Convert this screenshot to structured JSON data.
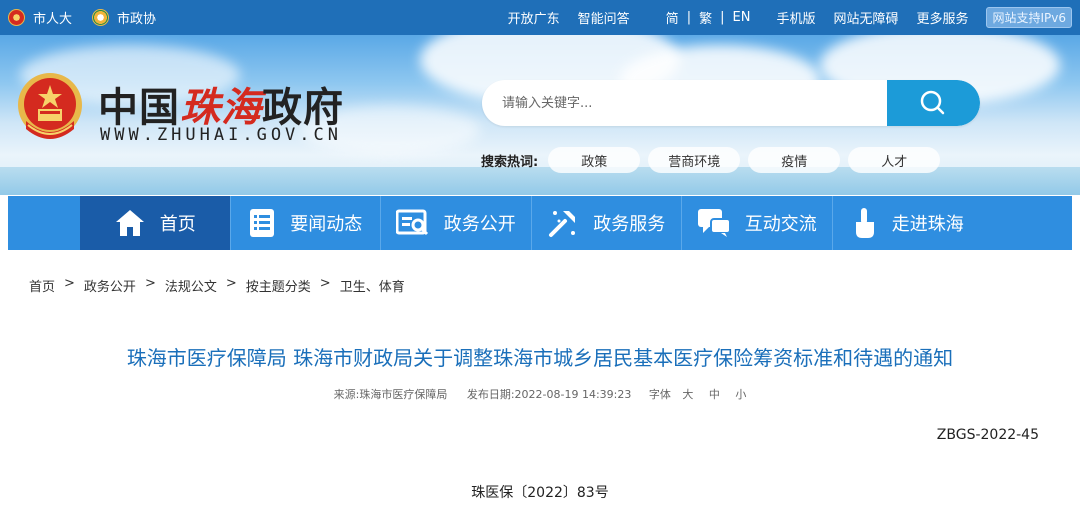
{
  "topbar": {
    "left_links": [
      {
        "label": "市人大",
        "icon": "national-emblem-icon"
      },
      {
        "label": "市政协",
        "icon": "cppcc-emblem-icon"
      }
    ],
    "right_links": [
      "开放广东",
      "智能问答"
    ],
    "languages": [
      "简",
      "繁",
      "EN"
    ],
    "lang_sep": "|",
    "more_links": [
      "手机版",
      "网站无障碍",
      "更多服务"
    ],
    "ipv6_badge": "网站支持IPv6"
  },
  "header": {
    "logo_cn_prefix": "中国",
    "logo_cn_city": "珠海",
    "logo_cn_suffix": "政府",
    "logo_en": "WWW.ZHUHAI.GOV.CN",
    "search": {
      "placeholder": "请输入关键字...",
      "icon": "search-icon"
    },
    "hot_label": "搜索热词:",
    "hot_tags": [
      "政策",
      "营商环境",
      "疫情",
      "人才"
    ]
  },
  "nav": {
    "items": [
      {
        "label": "首页",
        "icon": "home-icon"
      },
      {
        "label": "要闻动态",
        "icon": "news-list-icon"
      },
      {
        "label": "政务公开",
        "icon": "document-search-icon"
      },
      {
        "label": "政务服务",
        "icon": "tools-icon"
      },
      {
        "label": "互动交流",
        "icon": "chat-icon"
      },
      {
        "label": "走进珠海",
        "icon": "pointer-hand-icon"
      }
    ]
  },
  "breadcrumb": [
    "首页",
    "政务公开",
    "法规公文",
    "按主题分类",
    "卫生、体育"
  ],
  "breadcrumb_sep": ">",
  "article": {
    "title": "珠海市医疗保障局 珠海市财政局关于调整珠海市城乡居民基本医疗保险筹资标准和待遇的通知",
    "source_label": "来源:",
    "source": "珠海市医疗保障局",
    "date_label": "发布日期:",
    "date": "2022-08-19 14:39:23",
    "font_label": "字体",
    "font_sizes": [
      "大",
      "中",
      "小"
    ],
    "doc_number": "ZBGS-2022-45",
    "doc_reference": "珠医保〔2022〕83号"
  },
  "colors": {
    "topbar": "#1f6fb8",
    "nav": "#2f8ee0",
    "nav_active": "#1a5ca8",
    "search_button": "#1c9bd8",
    "title": "#1a6fba",
    "logo_red": "#d42a1f"
  }
}
